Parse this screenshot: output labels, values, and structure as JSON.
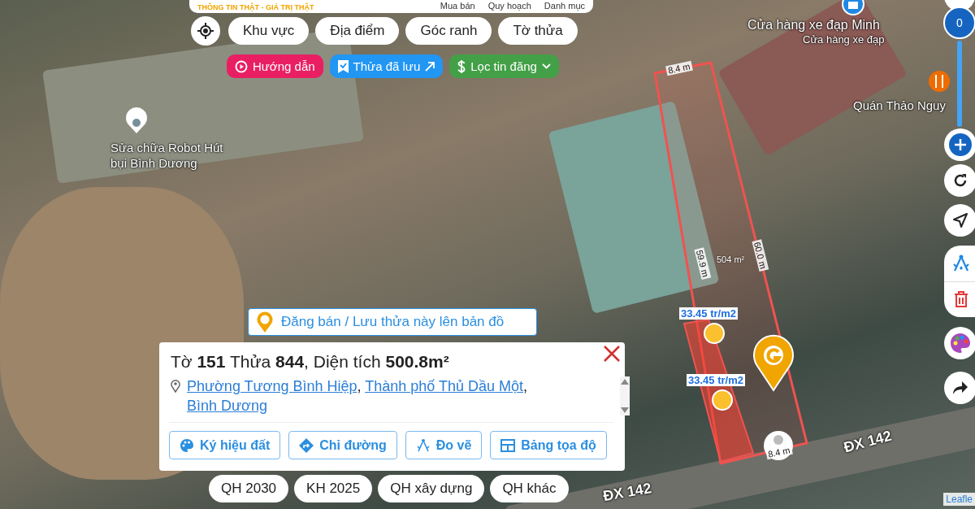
{
  "header": {
    "tagline": "THÔNG TIN THẬT - GIÁ TRỊ THẬT",
    "menu": [
      "Mua bán",
      "Quy hoạch",
      "Danh mục"
    ]
  },
  "search_tabs": [
    "Khu vực",
    "Địa điểm",
    "Góc ranh",
    "Tờ thửa"
  ],
  "quick_actions": [
    {
      "kind": "guide",
      "label": "Hướng dẫn"
    },
    {
      "kind": "saved",
      "label": "Thửa đã lưu"
    },
    {
      "kind": "filter",
      "label": "Lọc tin đăng"
    }
  ],
  "zoom_level": "0",
  "map_labels": [
    {
      "kind": "shop",
      "text": "Cửa hàng xe đạp Minh"
    },
    {
      "kind": "shop_sub",
      "text": "Cửa hàng xe đạp"
    },
    {
      "kind": "restaurant",
      "text": "Quán Thảo Nguy"
    },
    {
      "kind": "place",
      "text": "Sửa chữa Robot Hút bụi Bình Dương"
    },
    {
      "kind": "road_right",
      "text": "ĐX 142"
    },
    {
      "kind": "road_left",
      "text": "ĐX 142"
    }
  ],
  "parcel": {
    "top_edge": "8.4 m",
    "left_edge": "59.9 m",
    "right_edge": "60.0 m",
    "bottom_edge": "8.4 m",
    "area": "504 m²",
    "prices": [
      "33.45 tr/m2",
      "33.45 tr/m2"
    ]
  },
  "post_button": "Đăng bán / Lưu thửa này lên bản đồ",
  "popup": {
    "title": "Tờ **151** Thửa **844**, Diện tích **500.8m²**",
    "address_links": [
      "Phường Tương Bình Hiệp",
      "Thành phố Thủ Dầu Một",
      "Bình Dương"
    ],
    "separator": ",",
    "actions": [
      {
        "kind": "palette",
        "label": "Ký hiệu đất"
      },
      {
        "kind": "directions",
        "label": "Chỉ đường"
      },
      {
        "kind": "measure",
        "label": "Đo vẽ"
      },
      {
        "kind": "table",
        "label": "Bảng tọa độ"
      }
    ]
  },
  "layers": [
    "QH 2030",
    "KH 2025",
    "QH xây dựng",
    "QH khác"
  ],
  "attribution": "Leafle"
}
